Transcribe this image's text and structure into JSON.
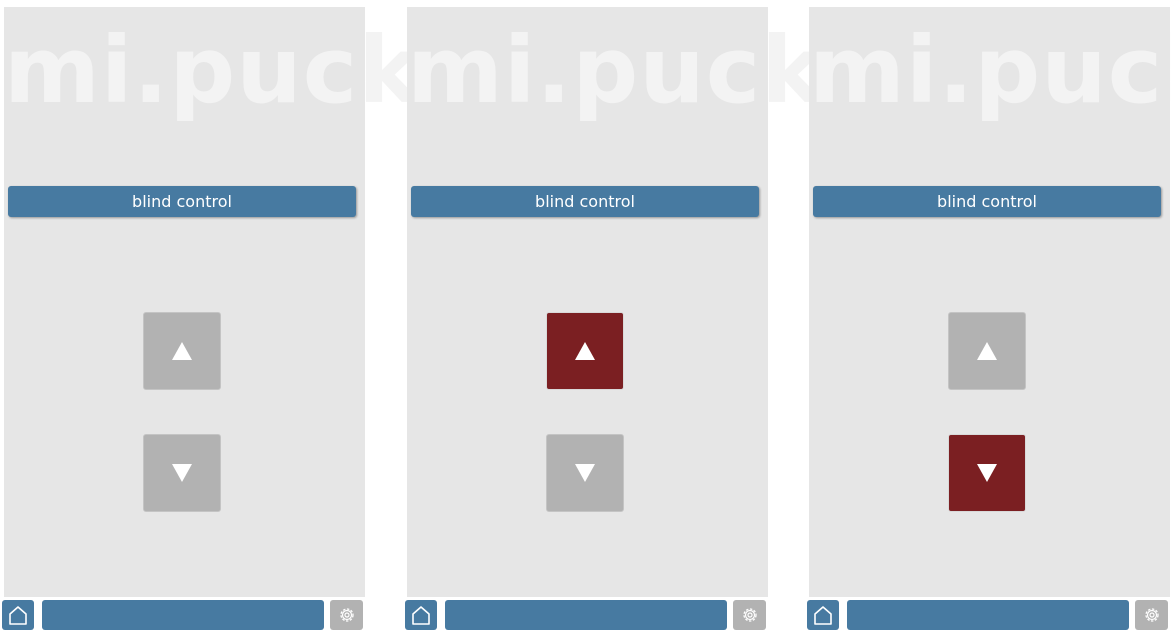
{
  "colors": {
    "screen_background": "#e6e6e6",
    "accent_blue": "#477aa1",
    "button_inactive": "#b2b2b2",
    "button_active": "#7b1f22"
  },
  "screens": [
    {
      "logo": "mi.puck",
      "title": "blind control",
      "up_button": {
        "icon": "arrow-up-icon",
        "state": "inactive"
      },
      "down_button": {
        "icon": "arrow-down-icon",
        "state": "inactive"
      },
      "home_icon": "home-icon",
      "settings_icon": "gear-icon"
    },
    {
      "logo": "mi.puck",
      "title": "blind control",
      "up_button": {
        "icon": "arrow-up-icon",
        "state": "active"
      },
      "down_button": {
        "icon": "arrow-down-icon",
        "state": "inactive"
      },
      "home_icon": "home-icon",
      "settings_icon": "gear-icon"
    },
    {
      "logo": "mi.puck",
      "title": "blind control",
      "up_button": {
        "icon": "arrow-up-icon",
        "state": "inactive"
      },
      "down_button": {
        "icon": "arrow-down-icon",
        "state": "active"
      },
      "home_icon": "home-icon",
      "settings_icon": "gear-icon"
    }
  ]
}
